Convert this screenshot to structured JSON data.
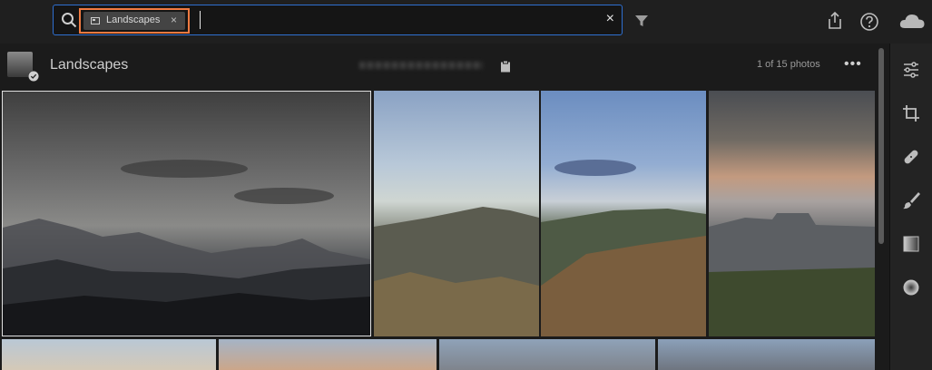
{
  "search": {
    "chip_label": "Landscapes",
    "chip_close": "×",
    "clear": "×"
  },
  "album": {
    "title": "Landscapes",
    "count": "1 of 15 photos",
    "more": "•••"
  },
  "icons": {
    "search": "search-icon",
    "filter": "filter-icon",
    "share": "share-icon",
    "help": "help-icon",
    "cloud": "cloud-icon",
    "copy": "clipboard-icon",
    "tools": [
      "edit-sliders-icon",
      "crop-icon",
      "healing-icon",
      "brush-icon",
      "linear-gradient-icon",
      "radial-gradient-icon"
    ]
  },
  "colors": {
    "accent_blue": "#2e6fd0",
    "highlight_orange": "#f07a42",
    "background": "#1b1b1b"
  }
}
